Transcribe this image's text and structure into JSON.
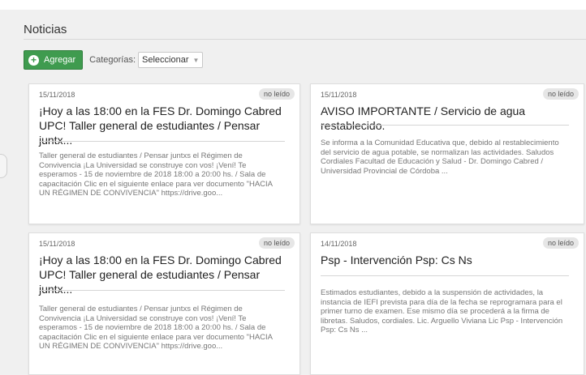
{
  "page": {
    "title": "Noticias"
  },
  "toolbar": {
    "add_label": "Agregar",
    "categories_label": "Categorías:",
    "categories_value": "Seleccionar"
  },
  "cards": [
    {
      "date": "15/11/2018",
      "badge": "no leído",
      "headline": "¡Hoy a las 18:00 en la FES Dr. Domingo Cabred UPC! Taller general de estudiantes / Pensar juntx...",
      "body": "Taller general de estudiantes / Pensar juntxs el Régimen de Convivencia ¡La Universidad se construye con vos! ¡Vení! Te esperamos - 15 de noviembre de 2018 18:00 a 20:00 hs. / Sala de capacitación Clic en el siguiente enlace para ver documento \"HACIA UN RÉGIMEN DE CONVIVENCIA\" https://drive.goo..."
    },
    {
      "date": "15/11/2018",
      "badge": "no leído",
      "headline": "AVISO IMPORTANTE / Servicio de agua restablecido.",
      "body": "Se informa a la Comunidad Educativa que, debido al restablecimiento del servicio de agua potable, se normalizan las actividades. Saludos Cordiales Facultad de Educación y Salud - Dr. Domingo Cabred / Universidad Provincial de Córdoba ..."
    },
    {
      "date": "15/11/2018",
      "badge": "no leído",
      "headline": "¡Hoy a las 18:00 en la FES Dr. Domingo Cabred UPC! Taller general de estudiantes / Pensar juntx...",
      "body": "Taller general de estudiantes / Pensar juntxs el Régimen de Convivencia ¡La Universidad se construye con vos! ¡Vení! Te esperamos - 15 de noviembre de 2018 18:00 a 20:00 hs. / Sala de capacitación Clic en el siguiente enlace para ver documento \"HACIA UN RÉGIMEN DE CONVIVENCIA\" https://drive.goo..."
    },
    {
      "date": "14/11/2018",
      "badge": "no leído",
      "headline": "Psp - Intervención Psp: Cs Ns",
      "body": "Estimados estudiantes, debido a la suspensión de actividades, la instancia de IEFI prevista para día de la fecha se reprogramara para el primer turno de examen. Ese mismo día se procederá a la firma de libretas. Saludos, cordiales. Lic. Arguello Viviana Lic Psp - Intervención Psp: Cs Ns ..."
    }
  ],
  "icons": {
    "add": "plus-circle-icon",
    "select": "chevron-down-icon"
  },
  "colors": {
    "accent": "#3f9b4f",
    "background": "#f0f0f0"
  }
}
